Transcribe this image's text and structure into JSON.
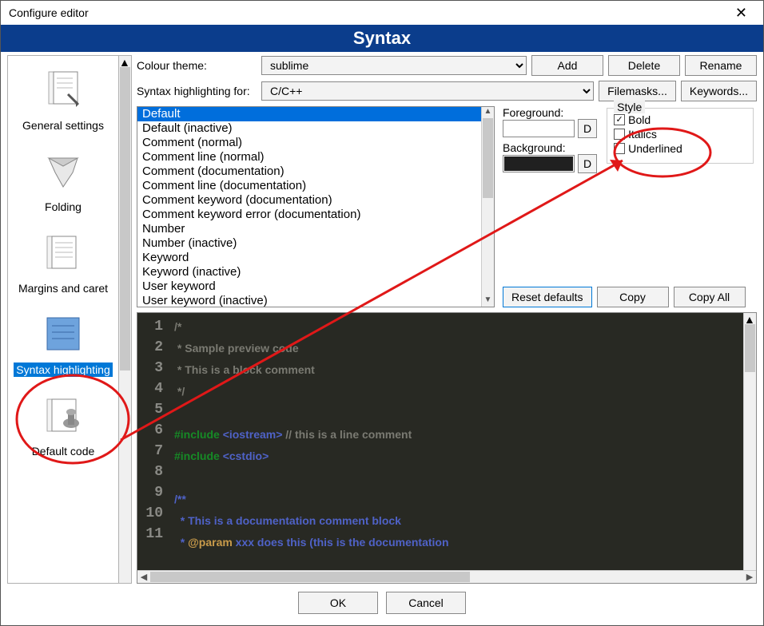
{
  "window": {
    "title": "Configure editor"
  },
  "banner": "Syntax",
  "sidebar": {
    "items": [
      {
        "label": "General settings"
      },
      {
        "label": "Folding"
      },
      {
        "label": "Margins and caret"
      },
      {
        "label": "Syntax highlighting"
      },
      {
        "label": "Default code"
      }
    ],
    "active_index": 3
  },
  "row1": {
    "label": "Colour theme:",
    "theme_options": [
      "sublime"
    ],
    "theme": "sublime",
    "add": "Add",
    "delete": "Delete",
    "rename": "Rename"
  },
  "row2": {
    "label": "Syntax highlighting for:",
    "lang_options": [
      "C/C++"
    ],
    "lang": "C/C++",
    "filemasks": "Filemasks...",
    "keywords": "Keywords..."
  },
  "style_items": [
    "Default",
    "Default (inactive)",
    "Comment (normal)",
    "Comment line (normal)",
    "Comment (documentation)",
    "Comment line (documentation)",
    "Comment keyword (documentation)",
    "Comment keyword error (documentation)",
    "Number",
    "Number (inactive)",
    "Keyword",
    "Keyword (inactive)",
    "User keyword",
    "User keyword (inactive)"
  ],
  "selected_style_index": 0,
  "color_panel": {
    "fg_label": "Foreground:",
    "fg_value": "#ffffff",
    "bg_label": "Background:",
    "bg_value": "#202020",
    "d_btn": "D"
  },
  "style_group": {
    "title": "Style",
    "bold": {
      "label": "Bold",
      "checked": true
    },
    "italics": {
      "label": "Italics",
      "checked": false
    },
    "underlined": {
      "label": "Underlined",
      "checked": false
    }
  },
  "actions": {
    "reset": "Reset defaults",
    "copy": "Copy",
    "copy_all": "Copy All"
  },
  "editor": {
    "line_numbers": [
      1,
      2,
      3,
      4,
      5,
      6,
      7,
      8,
      9,
      10,
      11
    ],
    "lines": [
      {
        "segs": [
          {
            "cls": "c-cmt",
            "t": "/*"
          }
        ]
      },
      {
        "segs": [
          {
            "cls": "c-cmt",
            "t": " * Sample preview code"
          }
        ]
      },
      {
        "segs": [
          {
            "cls": "c-cmt",
            "t": " * This is a block comment"
          }
        ]
      },
      {
        "segs": [
          {
            "cls": "c-cmt",
            "t": " */"
          }
        ]
      },
      {
        "segs": [
          {
            "cls": "",
            "t": ""
          }
        ]
      },
      {
        "segs": [
          {
            "cls": "c-pp",
            "t": "#include "
          },
          {
            "cls": "c-str",
            "t": "<iostream>"
          },
          {
            "cls": "",
            "t": " "
          },
          {
            "cls": "c-linecmt",
            "t": "// this is a line comment"
          }
        ]
      },
      {
        "segs": [
          {
            "cls": "c-pp",
            "t": "#include "
          },
          {
            "cls": "c-str",
            "t": "<cstdio>"
          }
        ]
      },
      {
        "segs": [
          {
            "cls": "",
            "t": ""
          }
        ]
      },
      {
        "segs": [
          {
            "cls": "c-doc",
            "t": "/**"
          }
        ]
      },
      {
        "segs": [
          {
            "cls": "c-doc",
            "t": "  * This is a documentation comment block"
          }
        ]
      },
      {
        "segs": [
          {
            "cls": "c-doc",
            "t": "  * "
          },
          {
            "cls": "c-doctag",
            "t": "@param"
          },
          {
            "cls": "c-doc",
            "t": " xxx does this (this is the documentation"
          }
        ]
      }
    ]
  },
  "footer": {
    "ok": "OK",
    "cancel": "Cancel"
  }
}
